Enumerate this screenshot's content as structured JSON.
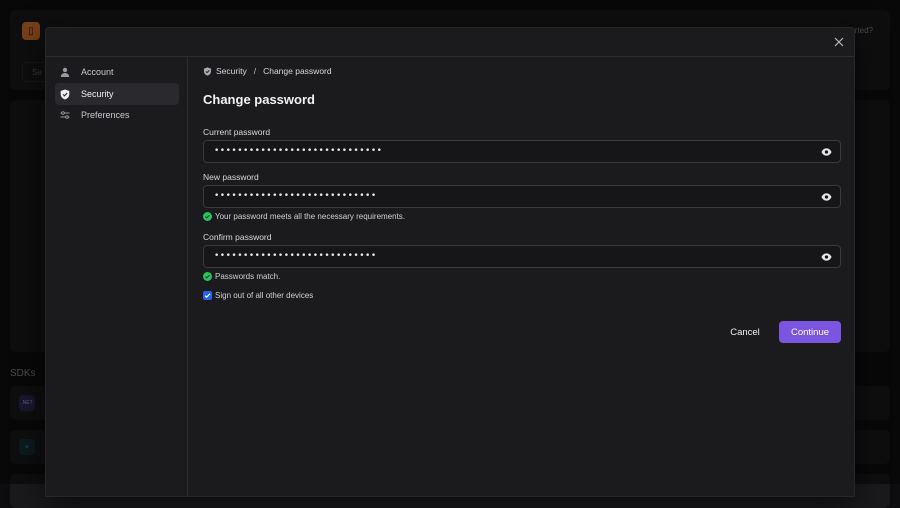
{
  "background": {
    "help_text": "rted?",
    "search_placeholder": "Se",
    "logo_glyph": "▯",
    "sdks_heading": "SDKs",
    "sdk_items": [
      {
        "icon_text": ".NET",
        "icon": "dotnet-icon"
      },
      {
        "icon_text": "∞",
        "icon": "link-icon"
      }
    ]
  },
  "modal": {
    "sidebar": {
      "items": [
        {
          "label": "Account",
          "icon": "user-icon",
          "active": false
        },
        {
          "label": "Security",
          "icon": "shield-icon",
          "active": true
        },
        {
          "label": "Preferences",
          "icon": "sliders-icon",
          "active": false
        }
      ]
    },
    "breadcrumb": {
      "items": [
        "Security",
        "Change password"
      ],
      "separator": "/"
    },
    "title": "Change password",
    "fields": {
      "current": {
        "label": "Current password",
        "value": "•••••••••••••••••••••••••••••"
      },
      "new": {
        "label": "New password",
        "value": "••••••••••••••••••••••••••••",
        "message": "Your password meets all the necessary requirements."
      },
      "confirm": {
        "label": "Confirm password",
        "value": "••••••••••••••••••••••••••••",
        "message": "Passwords match."
      }
    },
    "signout_checkbox": {
      "label": "Sign out of all other devices",
      "checked": true
    },
    "buttons": {
      "cancel": "Cancel",
      "continue": "Continue"
    }
  },
  "colors": {
    "accent": "#7b55e0",
    "success": "#22c55e",
    "checkbox": "#2563eb"
  }
}
